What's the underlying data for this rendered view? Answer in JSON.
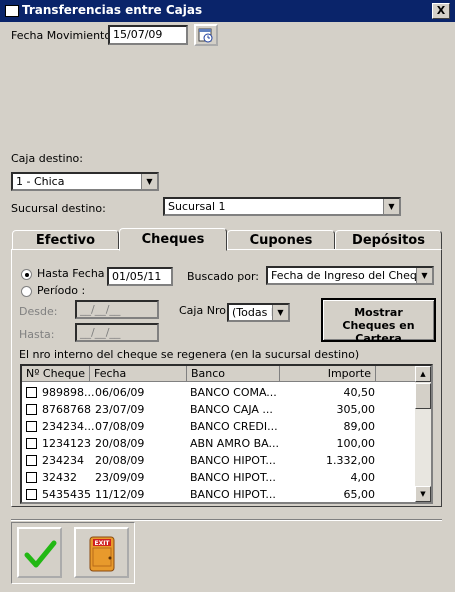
{
  "window": {
    "title": "Transferencias entre Cajas",
    "close_label": "X"
  },
  "fecha_movimiento": {
    "label": "Fecha Movimiento:",
    "value": "15/07/09"
  },
  "caja_destino": {
    "label": "Caja destino:",
    "value": "1 - Chica"
  },
  "sucursal_destino": {
    "label": "Sucursal destino:",
    "value": "Sucursal 1"
  },
  "tabs": [
    {
      "label": "Efectivo"
    },
    {
      "label": "Cheques"
    },
    {
      "label": "Cupones"
    },
    {
      "label": "Depósitos"
    }
  ],
  "cheques": {
    "hasta_fecha_label": "Hasta Fecha :",
    "hasta_fecha_value": "01/05/11",
    "periodo_label": "Período :",
    "desde_label": "Desde:",
    "desde_value": "__/__/__",
    "hasta_label": "Hasta:",
    "hasta_value": "__/__/__",
    "buscado_por_label": "Buscado por:",
    "buscado_por_value": "Fecha de Ingreso del Cheque",
    "caja_nro_label": "Caja Nro:",
    "caja_nro_value": "(Todas la",
    "mostrar_button": "Mostrar Cheques en Cartera",
    "note": "El nro interno del cheque se regenera (en la sucursal destino)",
    "columns": [
      "Nº Cheque",
      "Fecha",
      "Banco",
      "Importe"
    ],
    "rows": [
      {
        "numero": "989898...",
        "fecha": "06/06/09",
        "banco": "BANCO COMA...",
        "importe": "40,50"
      },
      {
        "numero": "8768768",
        "fecha": "23/07/09",
        "banco": "BANCO CAJA ...",
        "importe": "305,00"
      },
      {
        "numero": "234234...",
        "fecha": "07/08/09",
        "banco": "BANCO CREDI...",
        "importe": "89,00"
      },
      {
        "numero": "1234123",
        "fecha": "20/08/09",
        "banco": "ABN AMRO BA...",
        "importe": "100,00"
      },
      {
        "numero": "234234",
        "fecha": "20/08/09",
        "banco": "BANCO HIPOT...",
        "importe": "1.332,00"
      },
      {
        "numero": "32432",
        "fecha": "23/09/09",
        "banco": "BANCO HIPOT...",
        "importe": "4,00"
      },
      {
        "numero": "5435435",
        "fecha": "11/12/09",
        "banco": "BANCO HIPOT...",
        "importe": "65,00"
      }
    ]
  },
  "footer": {
    "exit_sign": "EXIT"
  },
  "colors": {
    "titlebar": "#0a246a",
    "face": "#d4d0c8",
    "ok_green": "#22b814",
    "door": "#e89a2c"
  }
}
